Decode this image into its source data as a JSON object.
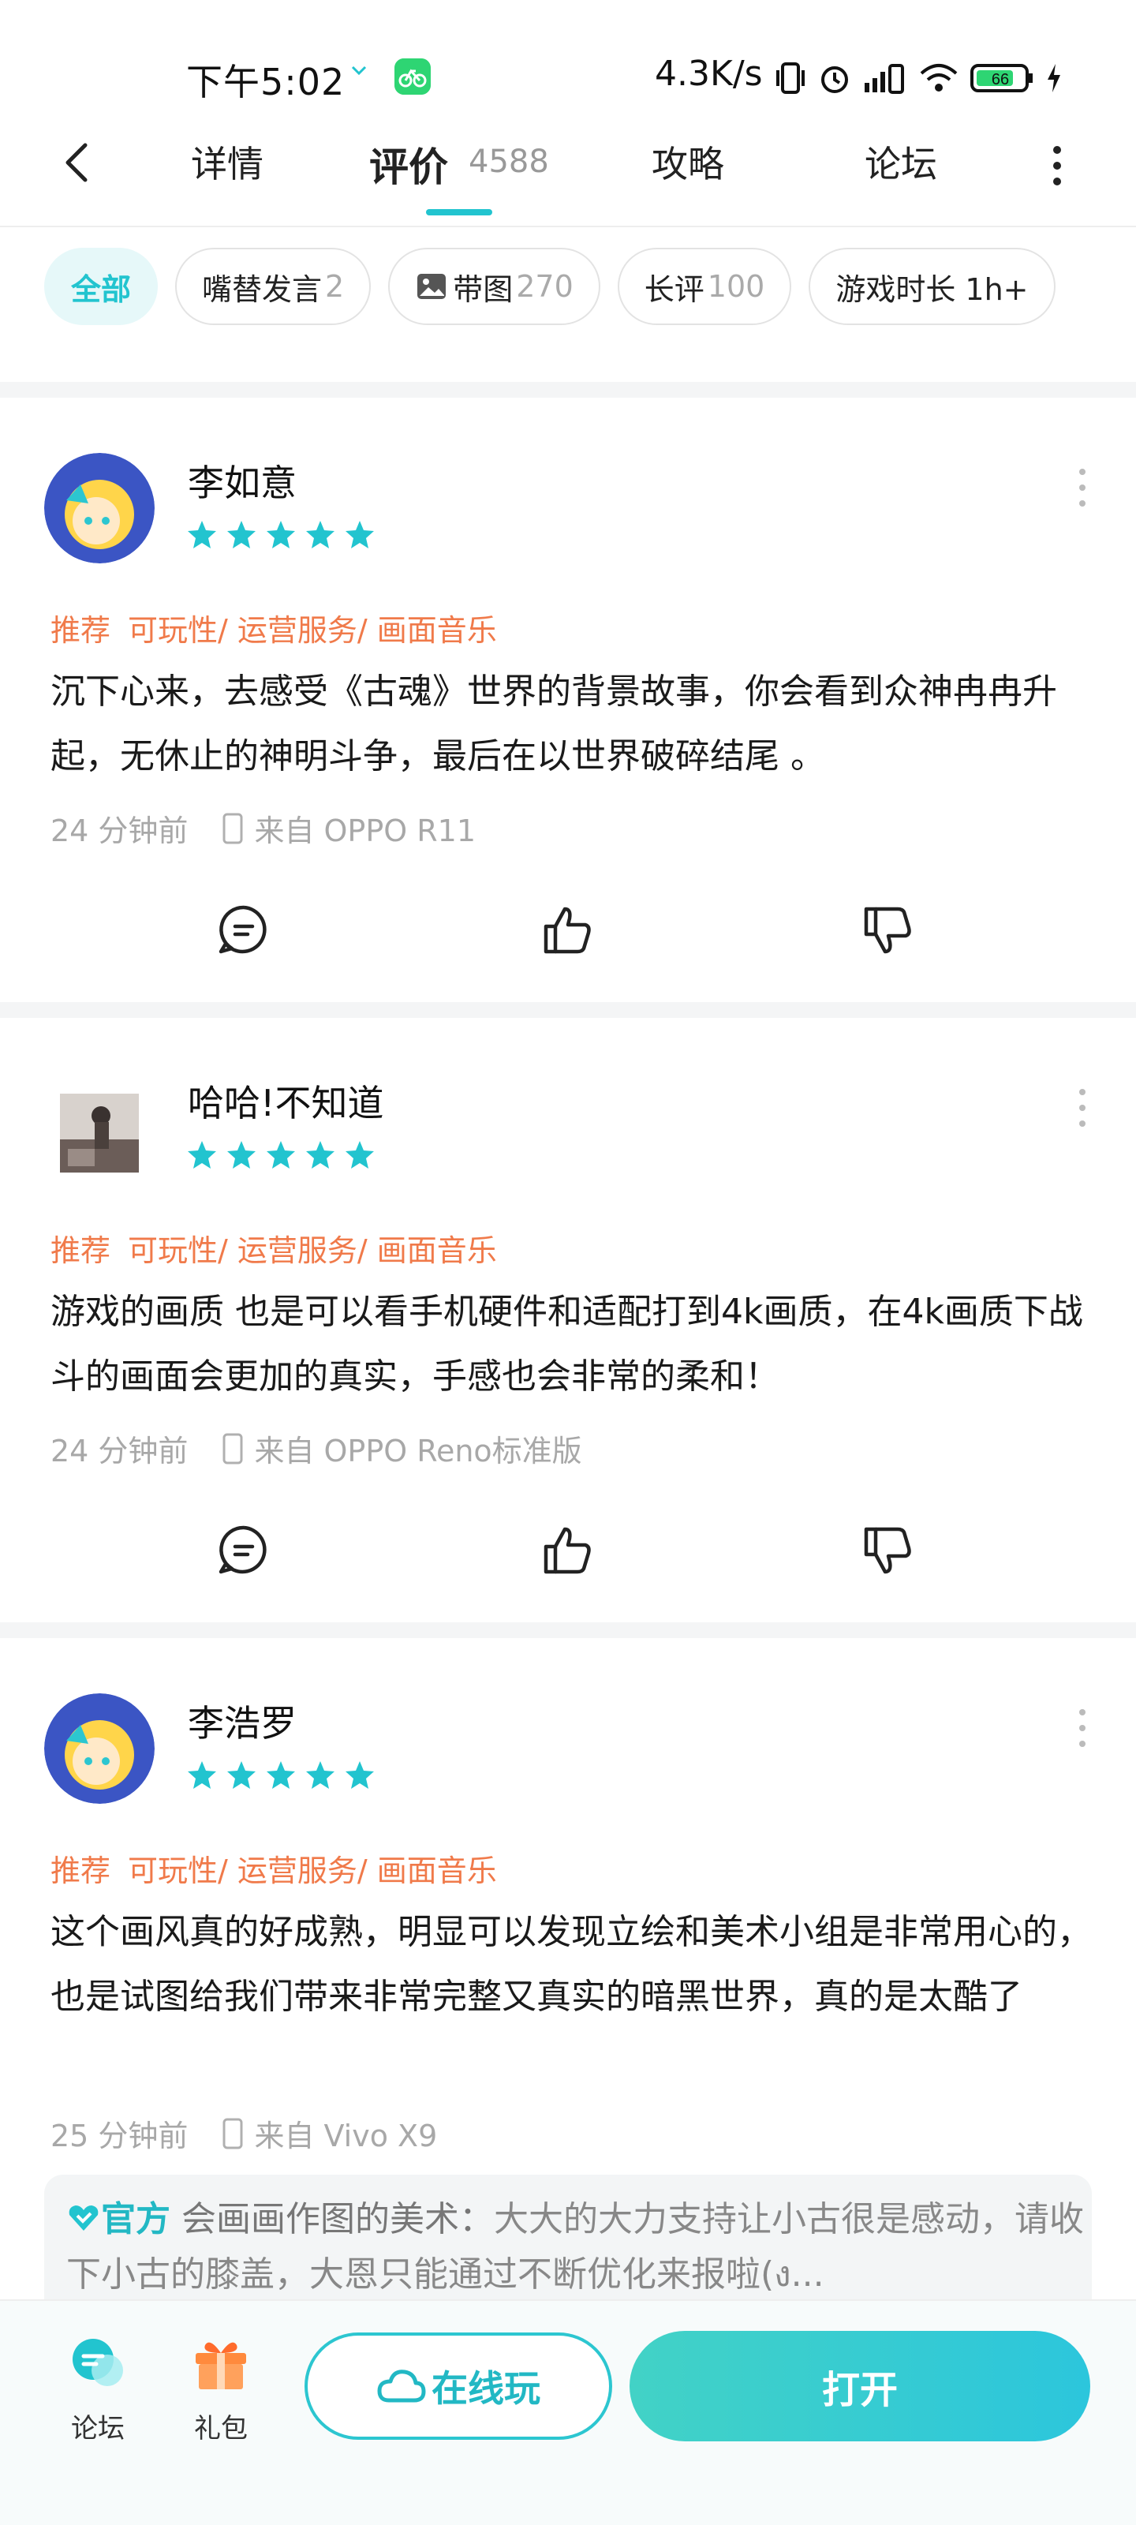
{
  "status_bar": {
    "time": "下午5:02",
    "speed": "4.3K/s",
    "battery": "66",
    "icons": [
      "vibrate-icon",
      "alarm-icon",
      "signal-icon",
      "wifi-icon",
      "battery-icon",
      "charging-icon"
    ]
  },
  "nav": {
    "tabs": [
      {
        "label": "详情"
      },
      {
        "label": "评价"
      },
      {
        "label": "攻略"
      },
      {
        "label": "论坛"
      }
    ],
    "review_count": "4588",
    "accent_color": "#22c4cf"
  },
  "filters": [
    {
      "label": "全部",
      "count": ""
    },
    {
      "label": "嘴替发言",
      "count": "2"
    },
    {
      "label": "带图",
      "count": "270"
    },
    {
      "label": "长评",
      "count": "100"
    },
    {
      "label": "游戏时长 1h+",
      "count": ""
    }
  ],
  "reviews": [
    {
      "user": "李如意",
      "rating": 5,
      "tag_recommend": "推荐",
      "tags": "可玩性/ 运营服务/ 画面音乐",
      "text": "沉下心来，去感受《古魂》世界的背景故事，你会看到众神冉冉升起，无休止的神明斗争，最后在以世界破碎结尾 。",
      "time": "24 分钟前",
      "device": "来自 OPPO R11"
    },
    {
      "user": "哈哈!不知道",
      "rating": 5,
      "tag_recommend": "推荐",
      "tags": "可玩性/ 运营服务/ 画面音乐",
      "text": "游戏的画质 也是可以看手机硬件和适配打到4k画质，在4k画质下战斗的画面会更加的真实，手感也会非常的柔和！",
      "time": "24 分钟前",
      "device": "来自 OPPO Reno标准版"
    },
    {
      "user": "李浩罗",
      "rating": 5,
      "tag_recommend": "推荐",
      "tags": "可玩性/ 运营服务/ 画面音乐",
      "text": "这个画风真的好成熟，明显可以发现立绘和美术小组是非常用心的，也是试图给我们带来非常完整又真实的暗黑世界，真的是太酷了",
      "time": "25 分钟前",
      "device": "来自 Vivo X9",
      "official_reply": {
        "label": "官方",
        "author": "会画画作图的美术：",
        "text": "大大的大力支持让小古很是感动，请收下小古的膝盖，大恩只能通过不断优化来报啦(ง..."
      }
    }
  ],
  "bottom_bar": {
    "forum": "论坛",
    "gift": "礼包",
    "play_online": "在线玩",
    "open": "打开"
  }
}
